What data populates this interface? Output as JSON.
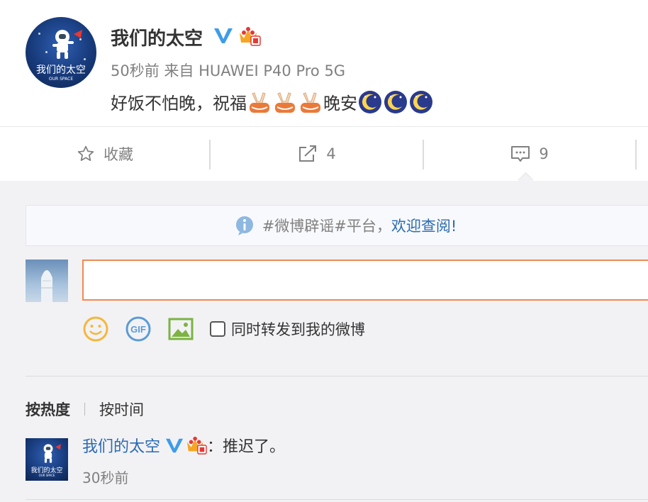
{
  "post": {
    "author_name": "我们的太空",
    "avatar_text": "我们的太空",
    "avatar_subtext": "OUR SPACE",
    "timestamp": "50秒前",
    "source_prefix": "来自",
    "source_device": "HUAWEI P40 Pro 5G",
    "text_part1": "好饭不怕晚，祝福",
    "text_part2": "晚安"
  },
  "actions": {
    "favorite_label": "收藏",
    "repost_count": "4",
    "comment_count": "9"
  },
  "notice": {
    "text": "#微博辟谣#平台，",
    "link_text": "欢迎查阅!"
  },
  "composer": {
    "placeholder": "",
    "forward_label": "同时转发到我的微博"
  },
  "sort": {
    "by_heat": "按热度",
    "by_time": "按时间"
  },
  "comment": {
    "author_name": "我们的太空",
    "separator": "：",
    "text": "推迟了。",
    "timestamp": "30秒前",
    "avatar_text": "我们的太空",
    "avatar_subtext": "OUR SPACE"
  },
  "colors": {
    "link_blue": "#2b6bb1",
    "verified_blue": "#3f9ce8",
    "input_border_orange": "#f08a53",
    "emoji_yellow": "#f5b73b",
    "image_icon_green": "#7cb342"
  }
}
